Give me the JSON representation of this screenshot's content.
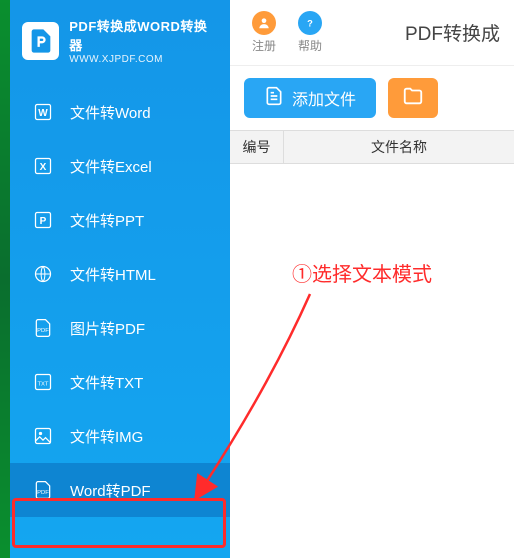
{
  "logo": {
    "title": "PDF转换成WORD转换器",
    "sub": "WWW.XJPDF.COM"
  },
  "sidebar": {
    "items": [
      {
        "label": "文件转Word"
      },
      {
        "label": "文件转Excel"
      },
      {
        "label": "文件转PPT"
      },
      {
        "label": "文件转HTML"
      },
      {
        "label": "图片转PDF"
      },
      {
        "label": "文件转TXT"
      },
      {
        "label": "文件转IMG"
      },
      {
        "label": "Word转PDF"
      }
    ]
  },
  "top": {
    "register": "注册",
    "help": "帮助",
    "title": "PDF转换成"
  },
  "toolbar": {
    "add_file": "添加文件"
  },
  "table": {
    "col_num": "编号",
    "col_name": "文件名称"
  },
  "annotation": "①选择文本模式"
}
